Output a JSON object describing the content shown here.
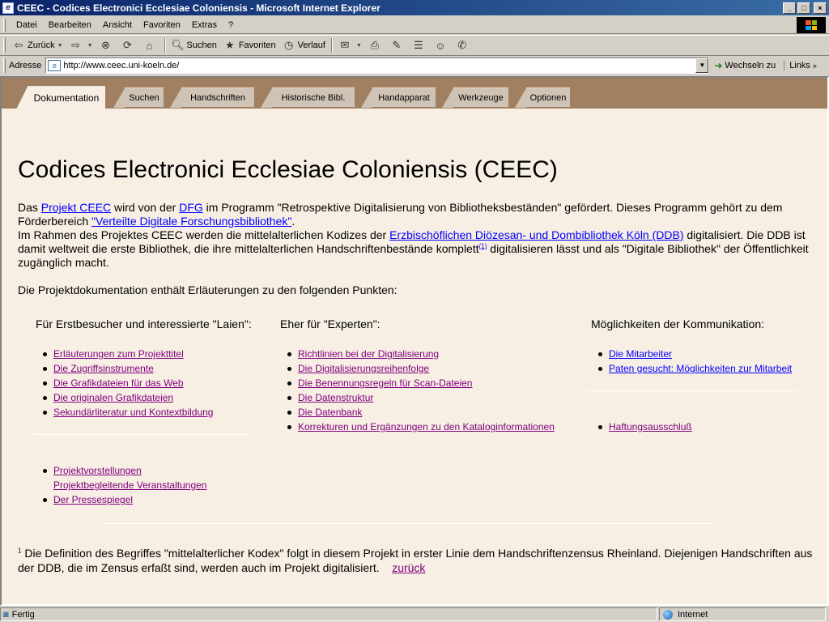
{
  "window": {
    "title": "CEEC - Codices Electronici Ecclesiae Coloniensis - Microsoft Internet Explorer",
    "buttons": {
      "minimize": "_",
      "maximize": "□",
      "close": "×"
    }
  },
  "menu": [
    "Datei",
    "Bearbeiten",
    "Ansicht",
    "Favoriten",
    "Extras",
    "?"
  ],
  "toolbar": {
    "back": "Zurück",
    "search": "Suchen",
    "favorites": "Favoriten",
    "history": "Verlauf"
  },
  "address": {
    "label": "Adresse",
    "url": "http://www.ceec.uni-koeln.de/",
    "go": "Wechseln zu",
    "links": "Links"
  },
  "tabs": [
    "Dokumentation",
    "Suchen",
    "Handschriften",
    "Historische Bibl.",
    "Handapparat",
    "Werkzeuge",
    "Optionen"
  ],
  "page": {
    "title": "Codices Electronici Ecclesiae Coloniensis (CEEC)",
    "intro": {
      "t1": "Das ",
      "link_projekt": "Projekt CEEC",
      "t2": " wird von der ",
      "link_dfg": "DFG",
      "t3": " im Programm \"Retrospektive Digitalisierung von Bibliotheksbeständen\" gefördert. Dieses Programm gehört zu dem Förderbereich ",
      "link_bib": "\"Verteilte Digitale Forschungsbibliothek\"",
      "t4": ".",
      "t5": "Im Rahmen des Projektes CEEC werden die mittelalterlichen Kodizes der ",
      "link_ddb": "Erzbischöflichen Diözesan- und Dombibliothek Köln (DDB)",
      "t6": " digitalisiert. Die DDB ist damit weltweit die erste Bibliothek, die ihre mittelalterlichen Handschriftenbestände komplett",
      "footnote_ref": "(1)",
      "t7": " digitalisieren lässt und als \"Digitale Bibliothek\" der Öffentlichkeit zugänglich macht."
    },
    "sub_intro": "Die Projektdokumentation enthält Erläuterungen zu den folgenden Punkten:",
    "col1": {
      "heading": "Für Erstbesucher und interessierte \"Laien\":",
      "items": [
        "Erläuterungen zum Projekttitel",
        "Die Zugriffsinstrumente",
        "Die Grafikdateien für das Web",
        "Die originalen Grafikdateien",
        "Sekundärliteratur und Kontextbildung"
      ],
      "items2": [
        "Projektvorstellungen",
        "Projektbegleitende Veranstaltungen",
        "Der Pressespiegel"
      ]
    },
    "col2": {
      "heading": "Eher für \"Experten\":",
      "items": [
        "Richtlinien bei der Digitalisierung",
        "Die Digitalisierungsreihenfolge",
        "Die Benennungsregeln für Scan-Dateien",
        "Die Datenstruktur",
        "Die Datenbank",
        "Korrekturen und Ergänzungen zu den Kataloginformationen"
      ]
    },
    "col3": {
      "heading": "Möglichkeiten der Kommunikation:",
      "items": [
        "Die Mitarbeiter",
        "Paten gesucht: Möglichkeiten zur Mitarbeit"
      ],
      "items2": [
        "Haftungsausschluß"
      ]
    },
    "footnote": {
      "num": "1",
      "text": " Die Definition des Begriffes \"mittelalterlicher Kodex\" folgt in diesem Projekt in erster Linie dem Handschriftenzensus Rheinland. Diejenigen Handschriften aus der DDB, die im Zensus erfaßt sind, werden auch im Projekt digitalisiert.",
      "back": "zurück"
    }
  },
  "status": {
    "left": "Fertig",
    "zone": "Internet"
  }
}
